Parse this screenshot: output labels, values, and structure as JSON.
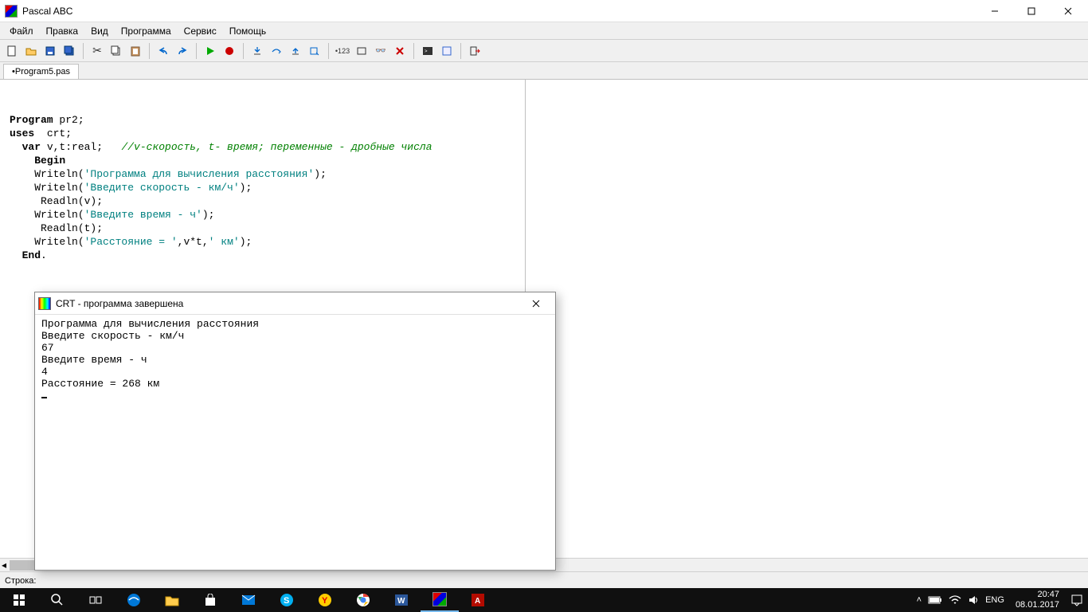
{
  "title": "Pascal ABC",
  "menu": [
    "Файл",
    "Правка",
    "Вид",
    "Программа",
    "Сервис",
    "Помощь"
  ],
  "tab": "•Program5.pas",
  "code": {
    "l2": [
      "Program",
      " pr2;"
    ],
    "l3": [
      "uses",
      "  crt;"
    ],
    "l4a": "  var",
    "l4b": " v,t:real;   ",
    "l4c": "//v-скорость, t- время; переменные - дробные числа",
    "l5": "    Begin",
    "l6a": "    Writeln(",
    "l6b": "'Программа для вычисления расстояния'",
    "l6c": ");",
    "l7a": "    Writeln(",
    "l7b": "'Введите скорость - км/ч'",
    "l7c": ");",
    "l8": "     Readln(v);",
    "l9a": "    Writeln(",
    "l9b": "'Введите время - ч'",
    "l9c": ");",
    "l10": "     Readln(t);",
    "l11a": "    Writeln(",
    "l11b": "'Расстояние = '",
    "l11c": ",v*t,",
    "l11d": "' км'",
    "l11e": ");",
    "l12": "  End",
    "l12b": "."
  },
  "crt": {
    "title": "CRT - программа завершена",
    "out": "Программа для вычисления расстояния\nВведите скорость - км/ч\n67\nВведите время - ч\n4\nРасстояние = 268 км"
  },
  "status": "Строка:",
  "tray": {
    "lang": "ENG",
    "time": "20:47",
    "date": "08.01.2017"
  }
}
